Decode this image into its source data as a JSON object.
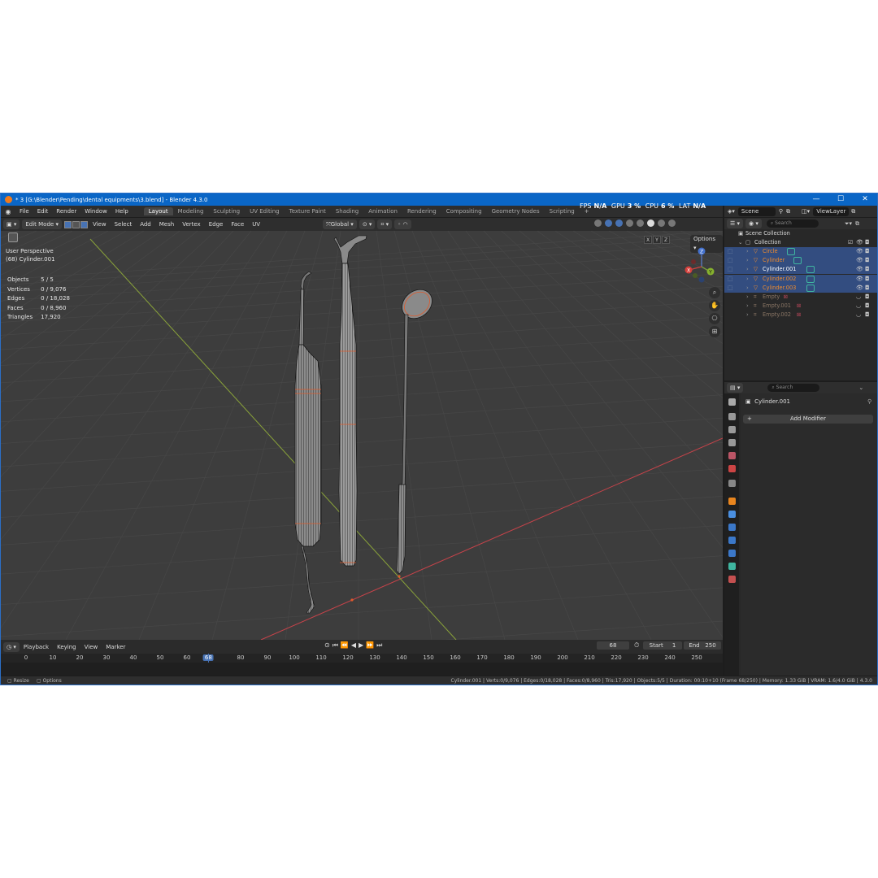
{
  "window": {
    "title": "* 3 [G:\\Blender\\Pending\\dental equipments\\3.blend] - Blender 4.3.0",
    "min": "—",
    "max": "☐",
    "close": "✕"
  },
  "menu": [
    "File",
    "Edit",
    "Render",
    "Window",
    "Help"
  ],
  "workspaces": [
    "Layout",
    "Modeling",
    "Sculpting",
    "UV Editing",
    "Texture Paint",
    "Shading",
    "Animation",
    "Rendering",
    "Compositing",
    "Geometry Nodes",
    "Scripting"
  ],
  "workspace_add": "+",
  "perf": {
    "fps_label": "FPS",
    "fps": "N/A",
    "gpu_label": "GPU",
    "gpu": "3 %",
    "cpu_label": "CPU",
    "cpu": "6 %",
    "lat_label": "LAT",
    "lat": "N/A"
  },
  "viewport_header": {
    "mode": "Edit Mode",
    "menus": [
      "View",
      "Select",
      "Add",
      "Mesh",
      "Vertex",
      "Edge",
      "Face",
      "UV"
    ],
    "orientation": "Global",
    "options": "Options",
    "axes": [
      "X",
      "Y",
      "Z"
    ]
  },
  "viewport": {
    "perspective": "User Perspective",
    "active": "(68) Cylinder.001",
    "stats": [
      {
        "label": "Objects",
        "value": "5 / 5"
      },
      {
        "label": "Vertices",
        "value": "0 / 9,076"
      },
      {
        "label": "Edges",
        "value": "0 / 18,028"
      },
      {
        "label": "Faces",
        "value": "0 / 8,960"
      },
      {
        "label": "Triangles",
        "value": "17,920"
      }
    ],
    "gizmo": {
      "x": "X",
      "y": "Y",
      "z": "Z"
    },
    "colors": {
      "grid": "#474747",
      "x_axis": "#c6434a",
      "y_axis": "#8aa33a",
      "wire": "#111111",
      "edge_sel": "#e05a2b"
    }
  },
  "timeline": {
    "menus": [
      "Playback",
      "Keying",
      "View",
      "Marker"
    ],
    "current_frame": "68",
    "start_label": "Start",
    "start": "1",
    "end_label": "End",
    "end": "250",
    "ticks": [
      "0",
      "10",
      "20",
      "30",
      "40",
      "50",
      "60",
      "68",
      "80",
      "90",
      "100",
      "110",
      "120",
      "130",
      "140",
      "150",
      "160",
      "170",
      "180",
      "190",
      "200",
      "210",
      "220",
      "230",
      "240",
      "250"
    ]
  },
  "status": {
    "left1": "Resize",
    "left2": "Options",
    "right": "Cylinder.001 | Verts:0/9,076 | Edges:0/18,028 | Faces:0/8,960 | Tris:17,920 | Objects:5/5 | Duration: 00:10+10 (Frame 68/250) | Memory: 1.33 GiB | VRAM: 1.6/4.0 GiB | 4.3.0"
  },
  "scene_bar": {
    "scene": "Scene",
    "viewlayer": "ViewLayer"
  },
  "outliner": {
    "search_placeholder": "Search",
    "root": "Scene Collection",
    "collection": "Collection",
    "items": [
      {
        "name": "Circle",
        "selected": true,
        "kind": "mesh"
      },
      {
        "name": "Cylinder",
        "selected": true,
        "kind": "mesh"
      },
      {
        "name": "Cylinder.001",
        "selected": true,
        "kind": "mesh",
        "active": true
      },
      {
        "name": "Cylinder.002",
        "selected": true,
        "kind": "mesh"
      },
      {
        "name": "Cylinder.003",
        "selected": true,
        "kind": "mesh"
      },
      {
        "name": "Empty",
        "selected": false,
        "kind": "empty"
      },
      {
        "name": "Empty.001",
        "selected": false,
        "kind": "empty"
      },
      {
        "name": "Empty.002",
        "selected": false,
        "kind": "empty"
      }
    ]
  },
  "properties": {
    "search_placeholder": "Search",
    "object": "Cylinder.001",
    "add_modifier": "Add Modifier"
  }
}
